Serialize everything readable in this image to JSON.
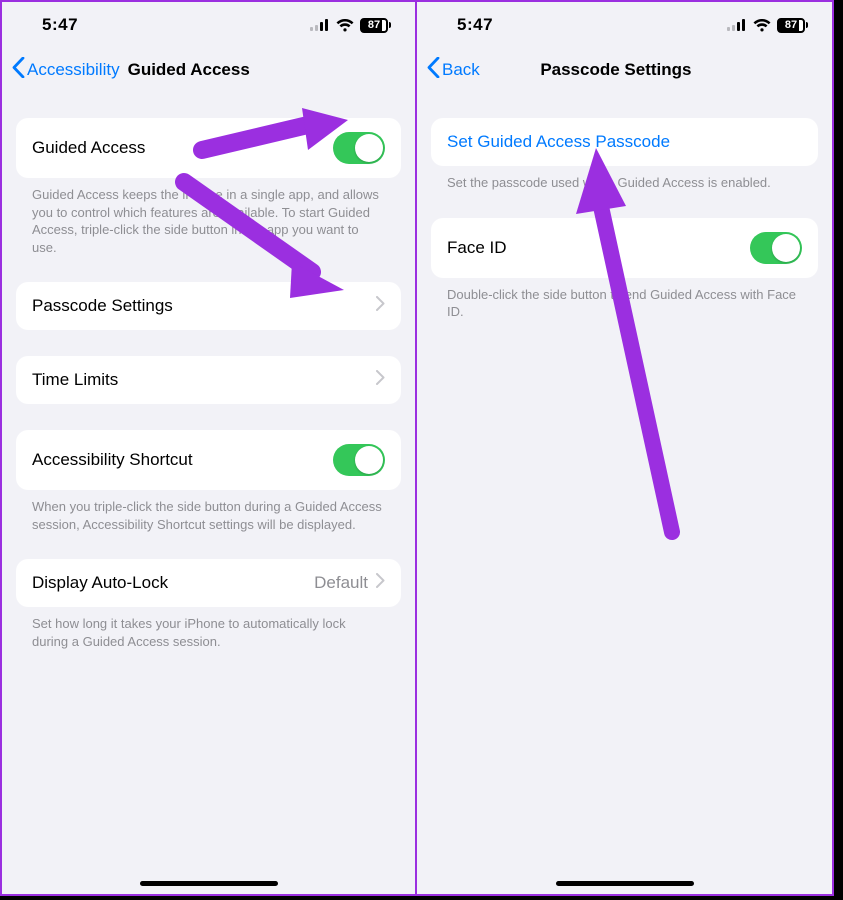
{
  "status": {
    "time": "5:47",
    "battery": "87"
  },
  "left": {
    "back_label": "Accessibility",
    "title": "Guided Access",
    "rows": {
      "guided_access": "Guided Access",
      "guided_access_footer": "Guided Access keeps the iPhone in a single app, and allows you to control which features are available. To start Guided Access, triple-click the side button in the app you want to use.",
      "passcode_settings": "Passcode Settings",
      "time_limits": "Time Limits",
      "accessibility_shortcut": "Accessibility Shortcut",
      "accessibility_shortcut_footer": "When you triple-click the side button during a Guided Access session, Accessibility Shortcut settings will be displayed.",
      "display_auto_lock": "Display Auto-Lock",
      "display_auto_lock_value": "Default",
      "display_auto_lock_footer": "Set how long it takes your iPhone to automatically lock during a Guided Access session."
    }
  },
  "right": {
    "back_label": "Back",
    "title": "Passcode Settings",
    "rows": {
      "set_passcode": "Set Guided Access Passcode",
      "set_passcode_footer": "Set the passcode used when Guided Access is enabled.",
      "face_id": "Face ID",
      "face_id_footer": "Double-click the side button to end Guided Access with Face ID."
    }
  }
}
